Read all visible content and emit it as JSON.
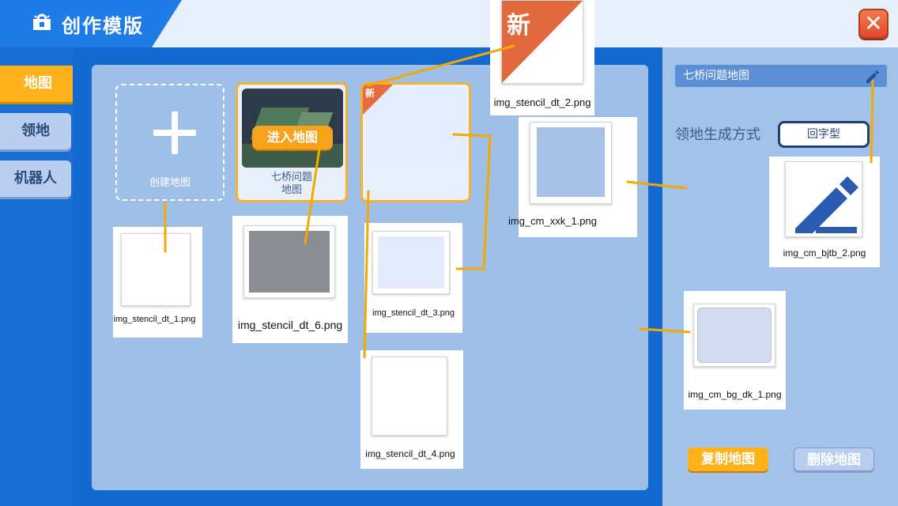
{
  "header": {
    "title": "创作模版",
    "title_icon": "lightbulb-icon",
    "close_icon": "close-icon",
    "close_glyph": "✕"
  },
  "nav": {
    "items": [
      {
        "label": "地图",
        "active": true
      },
      {
        "label": "领地",
        "active": false
      },
      {
        "label": "机器人",
        "active": false
      }
    ]
  },
  "main": {
    "create_card": {
      "label": "创建地图",
      "icon": "plus-icon"
    },
    "map_card": {
      "enter_label": "进入地图",
      "name_line1": "七桥问题",
      "name_line2": "地图"
    },
    "new_card": {
      "badge": "新"
    }
  },
  "right": {
    "map_name": "七桥问题地图",
    "edit_icon": "pencil-icon",
    "gen_label": "领地生成方式",
    "gen_value": "回字型",
    "copy_label": "复制地图",
    "delete_label": "删除地图"
  },
  "assets": [
    {
      "name": "img_stencil_dt_2.png",
      "badge": "新"
    },
    {
      "name": "img_cm_xxk_1.png"
    },
    {
      "name": "img_cm_bjtb_2.png"
    },
    {
      "name": "img_stencil_dt_1.png"
    },
    {
      "name": "img_stencil_dt_6.png"
    },
    {
      "name": "img_stencil_dt_3.png"
    },
    {
      "name": "img_stencil_dt_4.png"
    },
    {
      "name": "img_cm_bg_dk_1.png"
    }
  ],
  "colors": {
    "accent_orange": "#ffb21a",
    "brand_blue": "#1f7be5",
    "panel_blue": "#9ebfe8",
    "annotation_line": "#f5a800"
  }
}
